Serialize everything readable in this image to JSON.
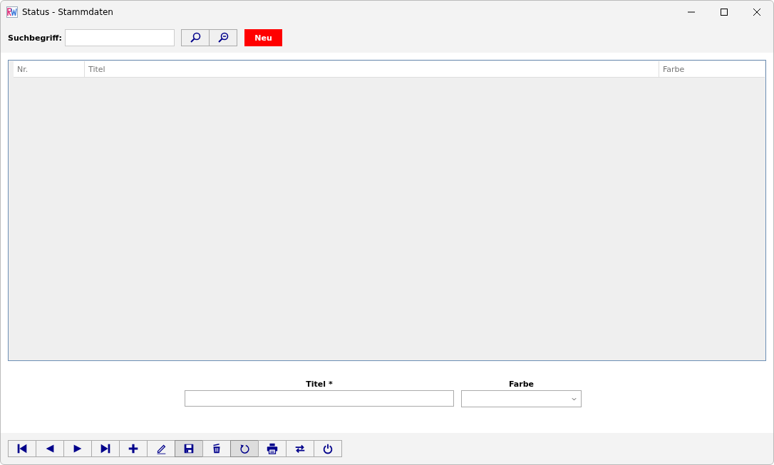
{
  "window": {
    "title": "Status - Stammdaten"
  },
  "search": {
    "label": "Suchbegriff:",
    "new_button": "Neu"
  },
  "table": {
    "columns": [
      "Nr.",
      "Titel",
      "Farbe"
    ]
  },
  "form": {
    "title_label": "Titel *",
    "color_label": "Farbe"
  },
  "toolbar": [
    {
      "kind": "first",
      "pressed": false
    },
    {
      "kind": "prev",
      "pressed": false
    },
    {
      "kind": "next",
      "pressed": false
    },
    {
      "kind": "last",
      "pressed": false
    },
    {
      "kind": "add",
      "pressed": false
    },
    {
      "kind": "edit",
      "pressed": false
    },
    {
      "kind": "save",
      "pressed": true
    },
    {
      "kind": "delete",
      "pressed": false
    },
    {
      "kind": "undo",
      "pressed": true
    },
    {
      "kind": "print",
      "pressed": false
    },
    {
      "kind": "swap",
      "pressed": false
    },
    {
      "kind": "power",
      "pressed": false
    }
  ]
}
